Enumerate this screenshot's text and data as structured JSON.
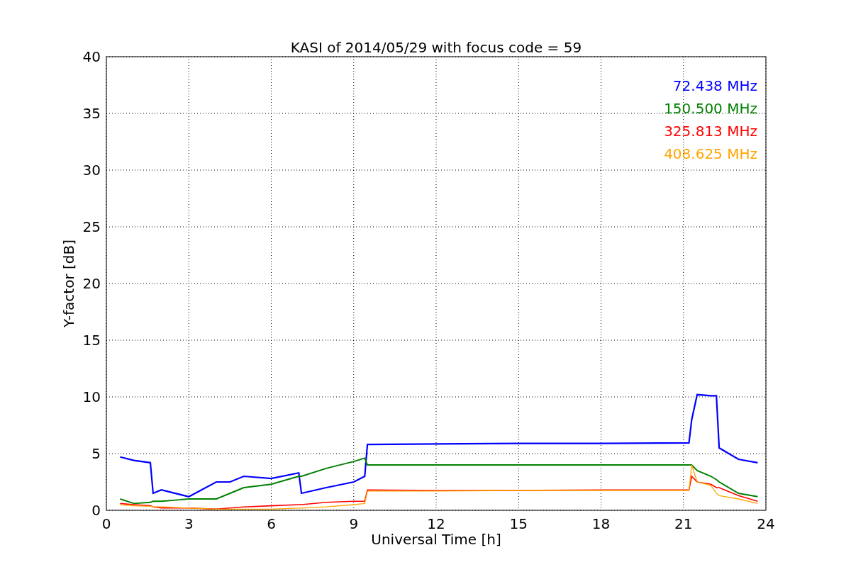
{
  "figure": {
    "chart_data": {
      "type": "line",
      "title": "KASI of 2014/05/29 with focus code = 59",
      "xlabel": "Universal Time [h]",
      "ylabel": "Y-factor [dB]",
      "x": [
        0.5,
        1,
        1.6,
        1.7,
        2,
        3,
        4,
        4.5,
        5,
        6,
        7,
        7.1,
        8,
        9,
        9.4,
        9.5,
        12,
        15,
        18,
        21.2,
        21.3,
        21.5,
        22,
        22.2,
        22.3,
        23,
        23.7
      ],
      "series": [
        {
          "name": "72.438 MHz",
          "color": "#0000ff",
          "values": [
            4.7,
            4.4,
            4.2,
            1.5,
            1.8,
            1.2,
            2.5,
            2.5,
            3,
            2.8,
            3.3,
            1.5,
            2,
            2.5,
            3,
            5.8,
            5.85,
            5.9,
            5.9,
            5.95,
            8,
            10.2,
            10.1,
            10.1,
            5.5,
            4.5,
            4.2
          ]
        },
        {
          "name": "150.500 MHz",
          "color": "#008000",
          "values": [
            1,
            0.6,
            0.7,
            0.8,
            0.8,
            1,
            1,
            1.5,
            2,
            2.3,
            3,
            3,
            3.7,
            4.3,
            4.6,
            4,
            4,
            4,
            4,
            4,
            4,
            3.5,
            3,
            2.7,
            2.5,
            1.5,
            1.2
          ]
        },
        {
          "name": "325.813 MHz",
          "color": "#ff0000",
          "values": [
            0.6,
            0.5,
            0.4,
            0.3,
            0.2,
            0.2,
            0.1,
            0.2,
            0.3,
            0.4,
            0.5,
            0.5,
            0.7,
            0.8,
            0.8,
            1.8,
            1.75,
            1.75,
            1.8,
            1.8,
            3,
            2.5,
            2.3,
            2,
            2,
            1.3,
            0.8
          ]
        },
        {
          "name": "408.625 MHz",
          "color": "#ffa500",
          "values": [
            0.5,
            0.4,
            0.35,
            0.3,
            0.3,
            0.2,
            0.1,
            0.1,
            0.1,
            0.1,
            0.2,
            0.2,
            0.3,
            0.5,
            0.6,
            1.7,
            1.7,
            1.75,
            1.75,
            1.75,
            4,
            2.5,
            2.2,
            1.5,
            1.3,
            1,
            0.6
          ]
        }
      ],
      "xlim": [
        0,
        24
      ],
      "ylim": [
        0,
        40
      ],
      "xticks": [
        0,
        3,
        6,
        9,
        12,
        15,
        18,
        21,
        24
      ],
      "yticks": [
        0,
        5,
        10,
        15,
        20,
        25,
        30,
        35,
        40
      ],
      "grid": true
    }
  }
}
